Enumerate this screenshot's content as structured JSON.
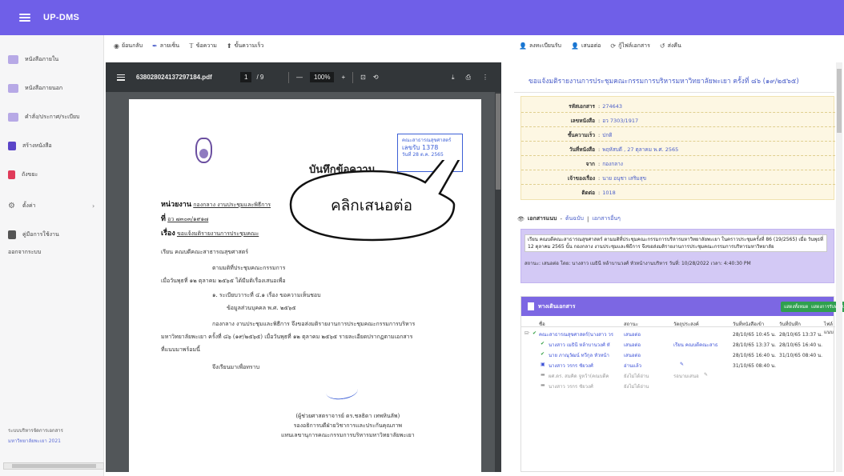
{
  "app": {
    "title": "UP-DMS"
  },
  "sidebar": {
    "items": [
      {
        "label": "หนังสือภายใน",
        "icon": "inbox-icon",
        "color": "#9c8ad8"
      },
      {
        "label": "หนังสือภายนอก",
        "icon": "mail-icon",
        "color": "#9c8ad8"
      },
      {
        "label": "คำสั่ง/ประกาศ/ระเบียบ",
        "icon": "announce-icon",
        "color": "#9c8ad8"
      },
      {
        "label": "สร้างหนังสือ",
        "icon": "create-doc-icon",
        "color": "#5b45c8"
      },
      {
        "label": "ถังขยะ",
        "icon": "trash-icon",
        "color": "#e03b5a"
      },
      {
        "label": "ตั้งค่า",
        "icon": "gear-icon",
        "color": "#666666"
      },
      {
        "label": "คู่มือการใช้งาน",
        "icon": "manual-icon",
        "color": "#555555"
      },
      {
        "label": "ออกจากระบบ",
        "icon": "",
        "color": ""
      }
    ],
    "footer_line1": "ระบบบริหารจัดการเอกสาร",
    "footer_line2": "มหาวิทยาลัยพะเยา 2021"
  },
  "toolbar_left": {
    "back": "ย้อนกลับ",
    "sign": "ลายเซ็น",
    "text": "ข้อความ",
    "quick": "ขั้นความเร็ว"
  },
  "toolbar_right": {
    "register": "ลงทะเบียนรับ",
    "forward": "เสนอต่อ",
    "restore": "กู้ไฟล์เอกสาร",
    "return": "ส่งคืน"
  },
  "pdf": {
    "filename": "638028024137297184.pdf",
    "page_current": "1",
    "page_total": "/ 9",
    "zoom": "100%",
    "memo_title": "บันทึกข้อความ",
    "stamp_line1": "คณะสาธารณสุขศาสตร์",
    "stamp_num": "เลขรับ 1378",
    "stamp_date": "วันที่ 28 ต.ค. 2565",
    "dept_label": "หน่วยงาน",
    "dept_value": "กองกลาง งานประชุมและพิธีการ",
    "no_label": "ที่",
    "no_value": "อว ๗๓๐๓/๑๙๑๗",
    "subject_label": "เรื่อง",
    "subject_value": "ขอแจ้งมติรายงานการประชุมคณะ",
    "to": "เรียน  คณบดีคณะสาธารณสุขศาสตร์",
    "body1": "ตามมติที่ประชุมคณะกรรมการ",
    "body2": "เมื่อวันพุธที่ ๑๒ ตุลาคม ๒๕๖๕ ได้มีมติเรื่องเสนอเพื่อ",
    "body3": "๑. ระเบียบวาระที่ ๔.๑ เรื่อง ขอความเห็นชอบ",
    "body4": "ข้อมูลส่วนบุคคล พ.ศ. ๒๕๖๕",
    "body5": "กองกลาง งานประชุมและพิธีการ จึงขอส่งมติรายงานการประชุมคณะกรรมการบริหาร",
    "body6": "มหาวิทยาลัยพะเยา ครั้งที่ ๘๖ (๑๙/๒๕๖๕) เมื่อวันพุธที่ ๑๒ ตุลาคม ๒๕๖๕ รายละเอียดปรากฏตามเอกสาร",
    "body7": "ที่แนบมาพร้อมนี้",
    "body8": "จึงเรียนมาเพื่อทราบ",
    "sig1": "(ผู้ช่วยศาสตราจารย์ ดร.ชลธิดา  เทพหินลัพ)",
    "sig2": "รองอธิการบดีฝ่ายวิชาการและประกันคุณภาพ",
    "sig3": "แทนเลขานุการคณะกรรมการบริหารมหาวิทยาลัยพะเยา"
  },
  "right": {
    "heading": "ขอแจ้งมติรายงานการประชุมคณะกรรมการบริหารมหาวิทยาลัยพะเยา ครั้งที่ ๘๖ (๑๙/๒๕๖๕)",
    "info": [
      {
        "label": "รหัสเอกสาร",
        "value": "274643"
      },
      {
        "label": "เลขหนังสือ",
        "value": "อว 7303/1917"
      },
      {
        "label": "ชั้นความเร็ว",
        "value": "ปกติ"
      },
      {
        "label": "วันที่หนังสือ",
        "value": "พฤหัสบดี , 27 ตุลาคม พ.ศ. 2565"
      },
      {
        "label": "จาก",
        "value": "กองกลาง"
      },
      {
        "label": "เจ้าของเรื่อง",
        "value": "นาย อนุชา เสริมสุข"
      },
      {
        "label": "ติดต่อ",
        "value": "1018"
      }
    ],
    "annot_title": "เอกสารแนบ",
    "annot_link1": "ต้นฉบับ",
    "annot_link2": "เอกสารอื่นๆ",
    "annot_text": "เรียน คณบดีคณะสาธารณสุขศาสตร์ ตามมติที่ประชุมคณะกรรมการบริหารมหาวิทยาลัยพะเยา ในคราวประชุมครั้งที่ 86 (19/2565) เมื่อ วันพุธที่ 12 ตุลาคม 2565 นั้น กองกลาง งานประชุมและพิธีการ จึงขอส่งมติรายงานการประชุมคณะกรรมการบริหารมหาวิทยาลัย",
    "annot_status": "สถานะ: เสนอต่อ  โดย: นางสาว เมธินี หล้าบานวงศ์ หัวหน้างานบริหาร  วันที่: 10/28/2022  เวลา: 4:40:30 PM",
    "docs_title": "ทางเดินเอกสาร",
    "docs_btn1": "แสดงทั้งหมด",
    "docs_btn2": "แสดงการรับทราบ",
    "cols": [
      "ชื่อ",
      "สถานะ",
      "วัตถุประสงค์",
      "วันที่หนังสือเข้า",
      "วันที่บันทึก",
      "ไฟล์แนบ"
    ],
    "rows": [
      {
        "name": "คณะสาธารณสุขศาสตร์(นางสาว วร",
        "status": "เสนอต่อ",
        "purpose": "",
        "in": "28/10/65 10:45 น.",
        "rec": "28/10/65 13:37 น."
      },
      {
        "name": "นางสาว เมธินี หล้าบานวงศ์ หั",
        "status": "เสนอต่อ",
        "purpose": "เรียน คณบดีคณะสาธ",
        "in": "28/10/65 13:37 น.",
        "rec": "28/10/65 16:40 น."
      },
      {
        "name": "นาย ภาณุวัฒน์ ทวีกุล หัวหน้า",
        "status": "เสนอต่อ",
        "purpose": "",
        "in": "28/10/65 16:40 น.",
        "rec": "31/10/65 08:40 น."
      },
      {
        "name": "นางสาว วรกร ชัยวงศ์",
        "status": "อ่านแล้ว",
        "purpose": "",
        "in": "31/10/65 08:40 น.",
        "rec": ""
      },
      {
        "name": "ผศ.ดร. สมคิด จูหว้า(คณบดีค",
        "status": "ยังไม่ได้อ่าน",
        "purpose": "รอนามเสนอ",
        "in": "",
        "rec": ""
      },
      {
        "name": "นางสาว วรกร ชัยวงศ์",
        "status": "ยังไม่ได้อ่าน",
        "purpose": "",
        "in": "",
        "rec": ""
      }
    ]
  },
  "callout": {
    "text": "คลิกเสนอต่อ"
  },
  "colors": {
    "topbar": "#6f5fe8",
    "panel": "#7c67e3",
    "link": "#4a5ec9",
    "annot_bg": "#d3c9f5"
  }
}
